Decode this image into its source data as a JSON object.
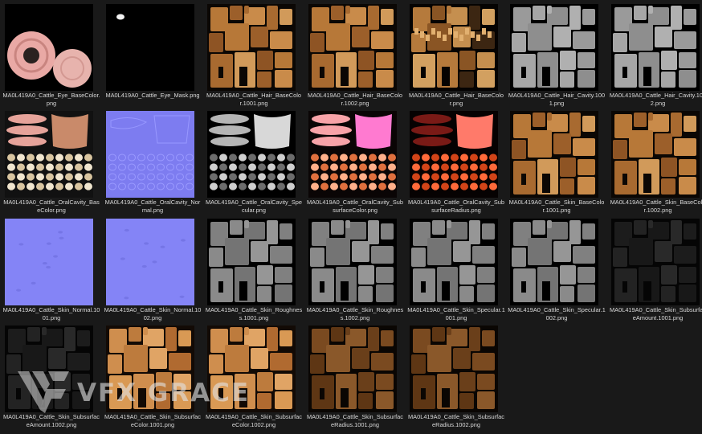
{
  "files": [
    {
      "name": "MA0L419A0_Cattle_Eye_BaseColor.png",
      "kind": "eye-base"
    },
    {
      "name": "MA0L419A0_Cattle_Eye_Mask.png",
      "kind": "eye-mask"
    },
    {
      "name": "MA0L419A0_Cattle_Hair_BaseColor.1001.png",
      "kind": "skin-color"
    },
    {
      "name": "MA0L419A0_Cattle_Hair_BaseColor.1002.png",
      "kind": "skin-color"
    },
    {
      "name": "MA0L419A0_Cattle_Hair_BaseColor.png",
      "kind": "hair-base"
    },
    {
      "name": "MA0L419A0_Cattle_Hair_Cavity.1001.png",
      "kind": "gray-light"
    },
    {
      "name": "MA0L419A0_Cattle_Hair_Cavity.1002.png",
      "kind": "gray-light"
    },
    {
      "name": "MA0L419A0_Cattle_OralCavity_BaseColor.png",
      "kind": "oral-base"
    },
    {
      "name": "MA0L419A0_Cattle_OralCavity_Normal.png",
      "kind": "oral-normal"
    },
    {
      "name": "MA0L419A0_Cattle_OralCavity_Specular.png",
      "kind": "oral-spec"
    },
    {
      "name": "MA0L419A0_Cattle_OralCavity_SubsurfaceColor.png",
      "kind": "oral-sss"
    },
    {
      "name": "MA0L419A0_Cattle_OralCavity_SubsurfaceRadius.png",
      "kind": "oral-radius"
    },
    {
      "name": "MA0L419A0_Cattle_Skin_BaseColor.1001.png",
      "kind": "skin-color"
    },
    {
      "name": "MA0L419A0_Cattle_Skin_BaseColor.1002.png",
      "kind": "skin-color"
    },
    {
      "name": "MA0L419A0_Cattle_Skin_Normal.1001.png",
      "kind": "normal"
    },
    {
      "name": "MA0L419A0_Cattle_Skin_Normal.1002.png",
      "kind": "normal"
    },
    {
      "name": "MA0L419A0_Cattle_Skin_Roughness.1001.png",
      "kind": "gray-mid"
    },
    {
      "name": "MA0L419A0_Cattle_Skin_Roughness.1002.png",
      "kind": "gray-mid"
    },
    {
      "name": "MA0L419A0_Cattle_Skin_Specular.1001.png",
      "kind": "gray-mid"
    },
    {
      "name": "MA0L419A0_Cattle_Skin_Specular.1002.png",
      "kind": "gray-mid"
    },
    {
      "name": "MA0L419A0_Cattle_Skin_SubsurfaceAmount.1001.png",
      "kind": "dark"
    },
    {
      "name": "MA0L419A0_Cattle_Skin_SubsurfaceAmount.1002.png",
      "kind": "dark"
    },
    {
      "name": "MA0L419A0_Cattle_Skin_SubsurfaceColor.1001.png",
      "kind": "sss-color"
    },
    {
      "name": "MA0L419A0_Cattle_Skin_SubsurfaceColor.1002.png",
      "kind": "sss-color"
    },
    {
      "name": "MA0L419A0_Cattle_Skin_SubsurfaceRadius.1001.png",
      "kind": "brown-dark"
    },
    {
      "name": "MA0L419A0_Cattle_Skin_SubsurfaceRadius.1002.png",
      "kind": "brown-dark"
    }
  ],
  "watermark": {
    "text": "VFX GRACE"
  },
  "colors": {
    "background": "#191919",
    "label": "#d9d9d9",
    "normal_map": "#8080ff"
  }
}
